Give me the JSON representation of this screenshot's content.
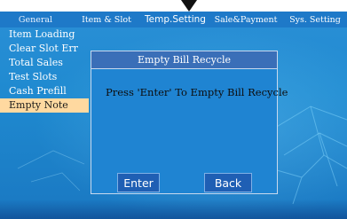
{
  "tabs": [
    {
      "label": "General",
      "active": true
    },
    {
      "label": "Item & Slot",
      "active": false
    },
    {
      "label": "Temp.Setting",
      "active": false
    },
    {
      "label": "Sale&Payment",
      "active": false
    },
    {
      "label": "Sys. Setting",
      "active": false
    }
  ],
  "menu": {
    "items": [
      {
        "label": "Item Loading",
        "selected": false
      },
      {
        "label": "Clear Slot Err",
        "selected": false
      },
      {
        "label": "Total Sales",
        "selected": false
      },
      {
        "label": "Test Slots",
        "selected": false
      },
      {
        "label": "Cash Prefill",
        "selected": false
      },
      {
        "label": "Empty Note",
        "selected": true
      }
    ]
  },
  "dialog": {
    "title": "Empty Bill Recycle",
    "message": "Press 'Enter' To Empty Bill Recycle",
    "enter_label": "Enter",
    "back_label": "Back"
  },
  "icons": {
    "pointer": "down-arrow-icon"
  },
  "colors": {
    "panel": "#1f8ad0",
    "selected_item": "#ffd9a0",
    "dialog_title": "#3a6fb8",
    "button": "#1f5fb4"
  }
}
